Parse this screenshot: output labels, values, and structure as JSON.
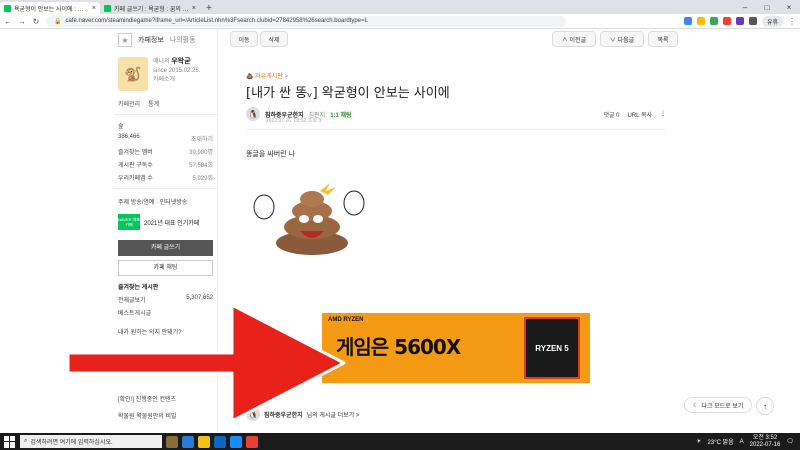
{
  "browser": {
    "tabs": [
      {
        "title": "욕굳형이 안보는 사이에 : 네이버",
        "active": true
      },
      {
        "title": "카페 글쓰기 : 욕굳형 : 꿈의 게시판",
        "active": false
      }
    ],
    "new_tab": "+",
    "url": "cafe.naver.com/steamindiegame?iframe_url=/ArticleList.nhn%3Fsearch.clubid=27842958%26search.boardtype=L",
    "profile_label": "유휴"
  },
  "sidebar": {
    "tab_info": "카페정보",
    "tab_activity": "나의활동",
    "manager_label": "매니저",
    "manager_name": "우왁굳",
    "since": "since 2015.02.26.",
    "intro": "카페소개",
    "manage": "카페관리",
    "stats_link": "통계",
    "level": "숲",
    "members": "386,466",
    "invite": "초대하기",
    "rows": [
      {
        "label": "즐겨찾는 멤버",
        "value": "39,980명"
      },
      {
        "label": "게시판 구독수",
        "value": "57,584회"
      },
      {
        "label": "우리카페앱 수",
        "value": "5,929회"
      }
    ],
    "theme": "주제 방송/연예 · 인터넷방송",
    "badge_text": "NAVER 대표카페",
    "badge_label": "2021년 대표 인기카페",
    "write_button": "카페 글쓰기",
    "chat_button": "카페 채팅",
    "fav_section": "즐겨찾는 게시판",
    "fav_items": [
      {
        "label": "전체글보기",
        "value": "5,307,652"
      },
      {
        "label": "베스트게시글",
        "value": ""
      }
    ],
    "peek1": "내가 원하는 의지 안돼기?",
    "peek2": "[확인!] 진행중인 컨텐츠",
    "peek3": "왁물원 왁물원만의 비밀"
  },
  "toolbar": {
    "move": "이동",
    "delete": "삭제",
    "prev": "∧ 이전글",
    "next": "∨ 다음글",
    "list": "목록"
  },
  "post": {
    "board": "💩 자유게시판 >",
    "title": "[내가 싼 똥ᵥ] 왁굳형이 안보는 사이에",
    "author": "침하중우군한지",
    "author_level": "침펀지",
    "chat_link": "1:1 채팅",
    "date": "2022.07.16. 03:52  조회 3",
    "comments": "댓글 0",
    "copy_url": "URL 복사",
    "more": "⋮",
    "body": "똥글을 싸버린 나"
  },
  "ad": {
    "brand": "AMD RYZEN",
    "headline": "게임은 5600X",
    "box_text": "RYZEN 5"
  },
  "footer": {
    "more_posts_author": "침하중우군한지",
    "more_posts": "님의 게시글 더보기 >",
    "dark_mode": "다크 모드로 보기",
    "top": "↑"
  },
  "taskbar": {
    "search_placeholder": "검색하려면 여기에 입력하십시오.",
    "weather": "23°C 맑음",
    "lang": "A",
    "time": "오전 3:52",
    "date": "2022-07-16"
  },
  "colors": {
    "naver_green": "#03c75a",
    "arrow_red": "#e8211a",
    "ad_orange": "#f59a14"
  }
}
